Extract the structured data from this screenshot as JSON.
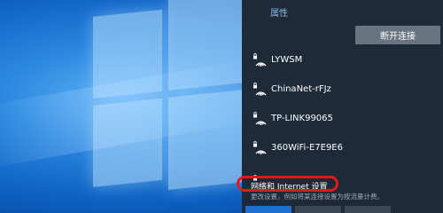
{
  "flyout": {
    "top_link": "属性",
    "disconnect_label": "断开连接",
    "networks": [
      {
        "ssid": "LYWSM",
        "secured": true
      },
      {
        "ssid": "ChinaNet-rFJz",
        "secured": true
      },
      {
        "ssid": "TP-LINK99065",
        "secured": true
      },
      {
        "ssid": "360WiFi-E7E9E6",
        "secured": true
      }
    ],
    "settings_link": "网络和 Internet 设置",
    "settings_sub": "更改设置，例如将某连接设置为按流量计费。",
    "quick_tiles": [
      {
        "color": "#1e6fd0"
      },
      {
        "color": "#3b4654"
      },
      {
        "color": "#3b4654"
      }
    ]
  },
  "colors": {
    "flyout_bg": "#1f2a38",
    "button_bg": "#6a7380",
    "link": "#8ab6ea",
    "highlight": "#e01a1a",
    "accent": "#1e6fd0"
  }
}
